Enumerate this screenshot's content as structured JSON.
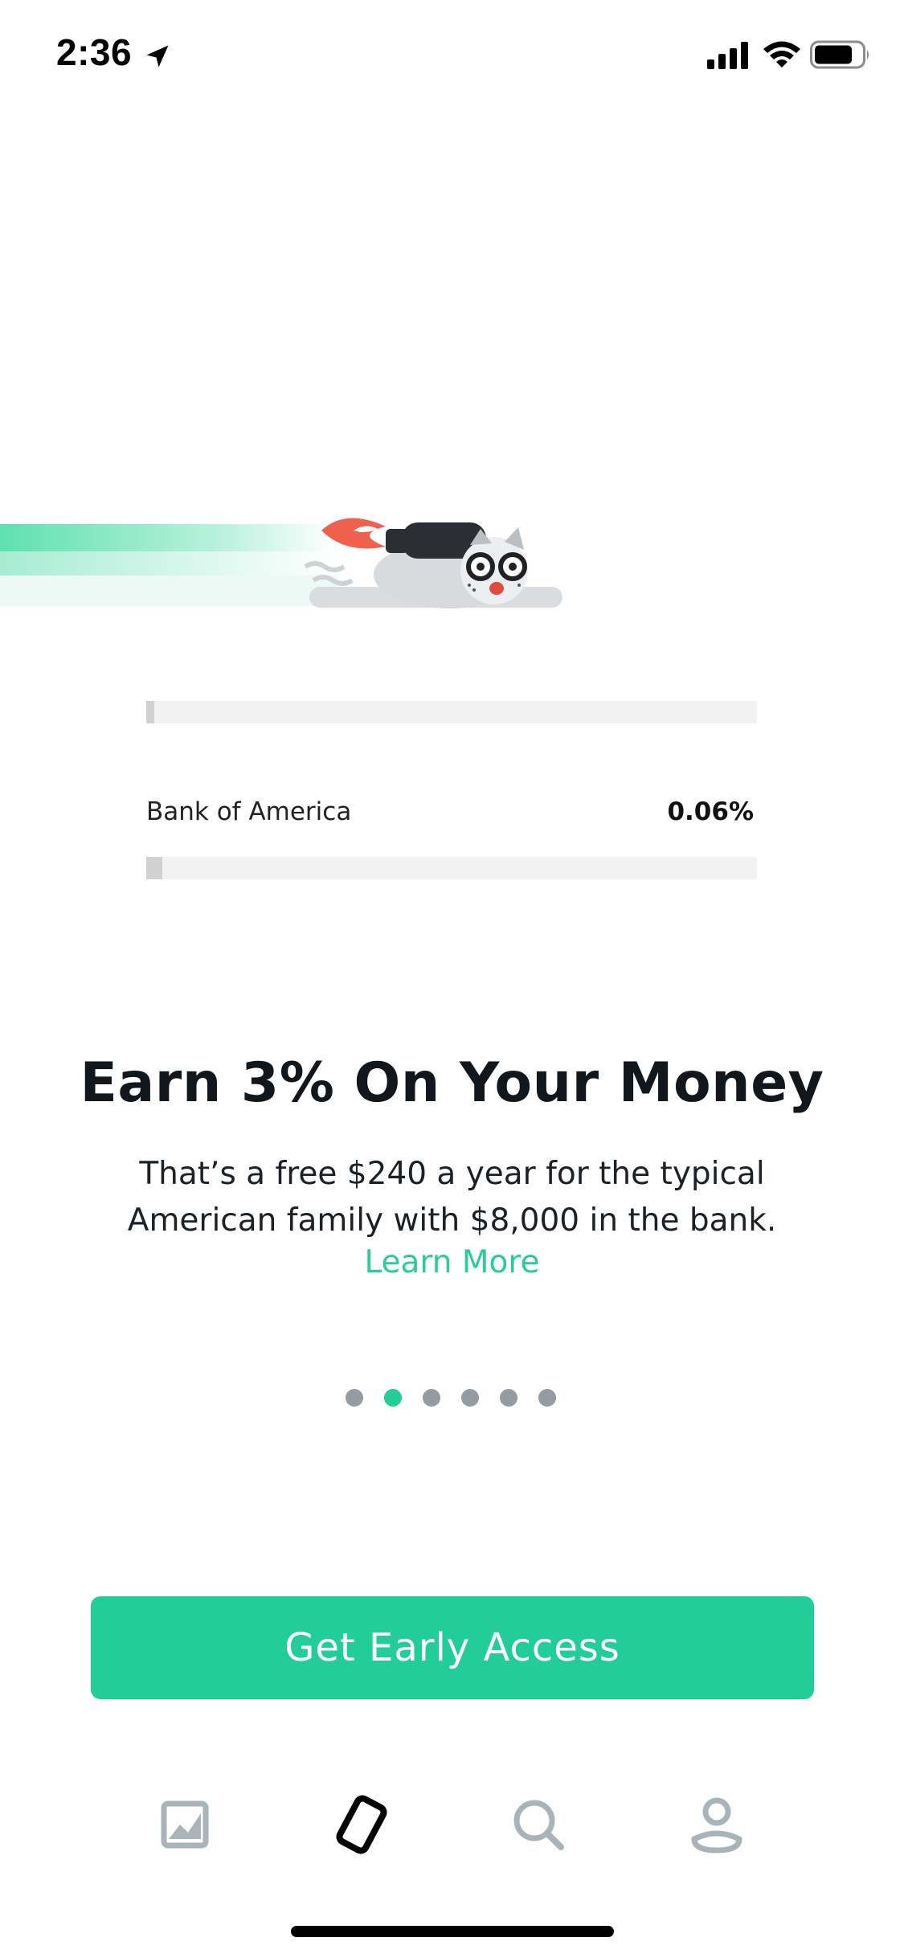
{
  "status_bar": {
    "time": "2:36",
    "icons": [
      "location-arrow-icon",
      "cellular-signal-icon",
      "wifi-icon",
      "battery-icon"
    ]
  },
  "hero": {
    "illustration": "raccoon-rocket-icon",
    "colors": {
      "trail": "#5fe0b0",
      "flame": "#f0614d",
      "body": "#d8dcdf"
    }
  },
  "comparison": {
    "top_bar_level": 0.013,
    "bank_name": "Bank of America",
    "bank_rate": "0.06%",
    "bank_bar_level": 0.026
  },
  "main": {
    "headline": "Earn 3% On Your Money",
    "body": "That’s a free $240 a year for the typical American family with $8,000 in the bank.",
    "learn_more": "Learn More"
  },
  "pager": {
    "count": 6,
    "active_index": 1
  },
  "cta": {
    "label": "Get Early Access"
  },
  "tab_bar": {
    "tabs": [
      {
        "icon": "chart-icon",
        "active": false
      },
      {
        "icon": "card-icon",
        "active": true
      },
      {
        "icon": "search-icon",
        "active": false
      },
      {
        "icon": "profile-icon",
        "active": false
      }
    ]
  },
  "colors": {
    "accent": "#22cd97",
    "link": "#2ccc98",
    "text": "#11171c",
    "inactive_icon": "#a9b4ba",
    "dot_inactive": "#949ca3",
    "bar_track": "#f2f2f2",
    "bar_fill": "#cfd1d3"
  }
}
